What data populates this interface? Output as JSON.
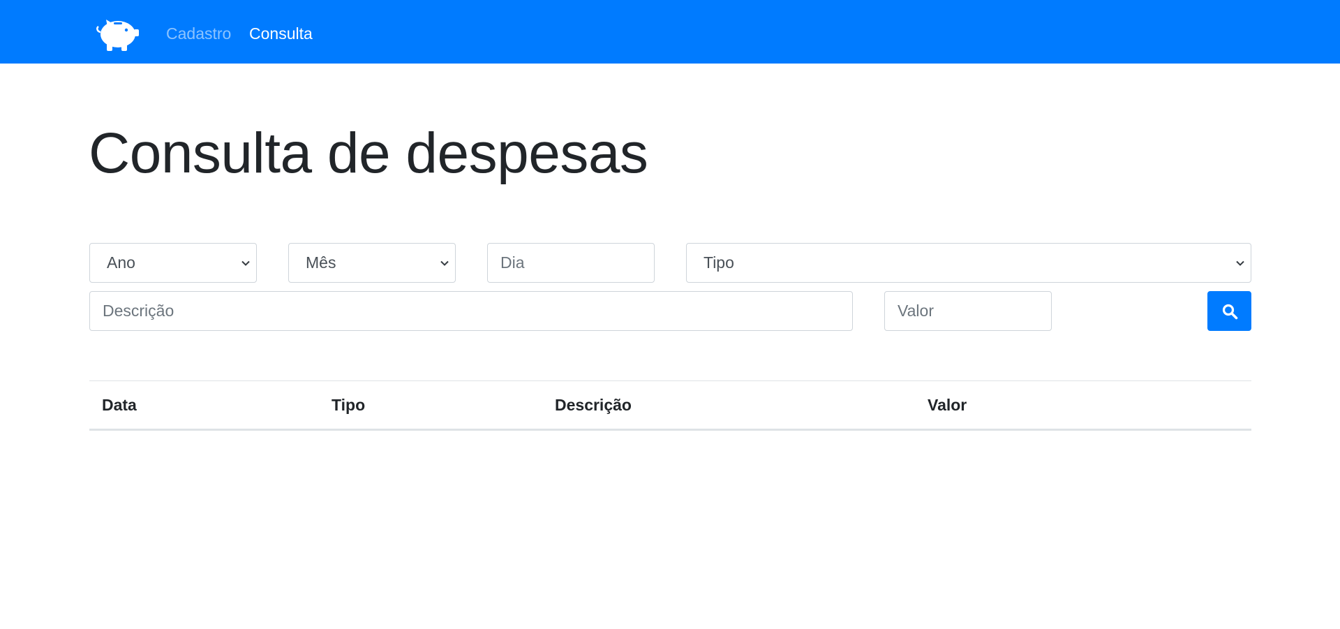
{
  "navbar": {
    "brand_icon": "piggy-bank-icon",
    "links": [
      {
        "label": "Cadastro",
        "active": false
      },
      {
        "label": "Consulta",
        "active": true
      }
    ],
    "background": "#007bff"
  },
  "page": {
    "title": "Consulta de despesas"
  },
  "filters": {
    "ano": {
      "selected": "Ano"
    },
    "mes": {
      "selected": "Mês"
    },
    "dia": {
      "placeholder": "Dia",
      "value": ""
    },
    "tipo": {
      "selected": "Tipo"
    },
    "descricao": {
      "placeholder": "Descrição",
      "value": ""
    },
    "valor": {
      "placeholder": "Valor",
      "value": ""
    },
    "search_button": {
      "icon": "search-icon",
      "color": "#007bff"
    }
  },
  "table": {
    "columns": [
      "Data",
      "Tipo",
      "Descrição",
      "Valor"
    ],
    "rows": []
  }
}
